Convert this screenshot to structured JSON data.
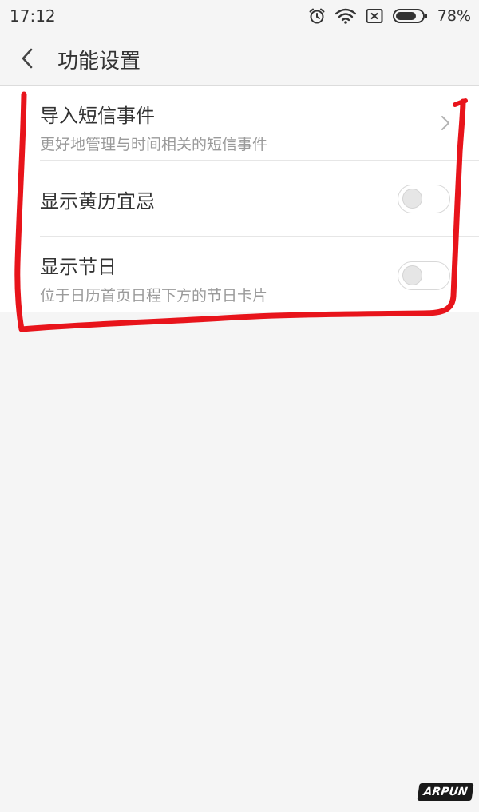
{
  "status_bar": {
    "time": "17:12",
    "battery_text": "78%",
    "battery_level": 0.78,
    "icons": [
      "alarm-icon",
      "wifi-icon",
      "sim-card-icon",
      "battery-icon"
    ]
  },
  "header": {
    "title": "功能设置",
    "back_icon": "chevron-left-icon"
  },
  "settings": {
    "items": [
      {
        "title": "导入短信事件",
        "subtitle": "更好地管理与时间相关的短信事件",
        "control": "chevron-right-icon"
      },
      {
        "title": "显示黄历宜忌",
        "subtitle": "",
        "control": "toggle",
        "enabled": false
      },
      {
        "title": "显示节日",
        "subtitle": "位于日历首页日程下方的节日卡片",
        "control": "toggle",
        "enabled": false
      }
    ]
  },
  "annotation": {
    "color": "#e8141b"
  },
  "watermark": {
    "text": "ARPUN"
  },
  "colors": {
    "background": "#f5f5f5",
    "card": "#ffffff",
    "text_primary": "#333333",
    "text_secondary": "#9a9a9a"
  }
}
